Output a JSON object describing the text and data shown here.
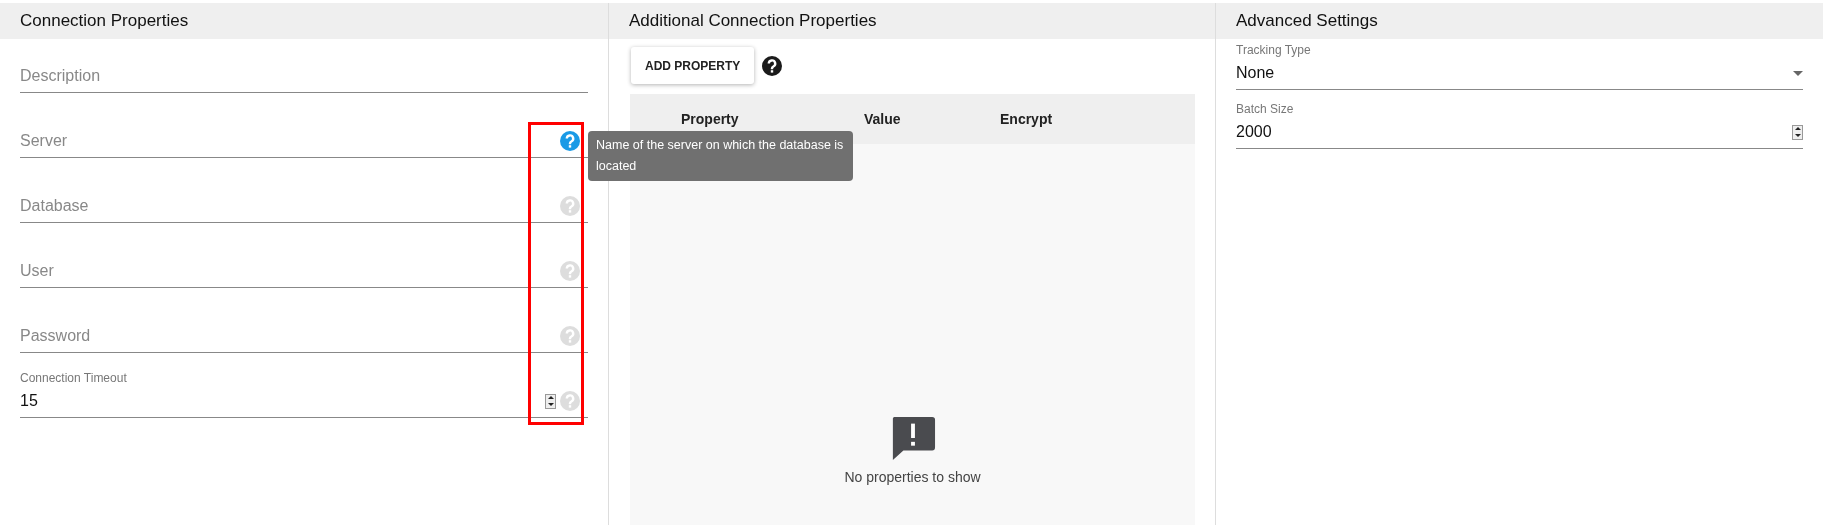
{
  "connection_properties": {
    "title": "Connection Properties",
    "fields": [
      {
        "kind": "text",
        "placeholder": "Description"
      },
      {
        "kind": "text",
        "placeholder": "Server",
        "help_highlighted": true
      },
      {
        "kind": "text",
        "placeholder": "Database",
        "help_highlighted": false
      },
      {
        "kind": "text",
        "placeholder": "User",
        "help_highlighted": false
      },
      {
        "kind": "password",
        "placeholder": "Password",
        "help_highlighted": false
      },
      {
        "kind": "number",
        "label": "Connection Timeout",
        "value": "15",
        "help_highlighted": false
      }
    ]
  },
  "additional_connection_properties": {
    "title": "Additional Connection Properties",
    "add_button": "ADD PROPERTY",
    "table": {
      "columns": [
        "Property",
        "Value",
        "Encrypt"
      ],
      "empty_message": "No properties to show"
    }
  },
  "advanced_settings": {
    "title": "Advanced Settings",
    "fields": [
      {
        "kind": "select",
        "label": "Tracking Type",
        "value": "None"
      },
      {
        "kind": "number",
        "label": "Batch Size",
        "value": "2000"
      }
    ]
  },
  "tooltip": {
    "text": "Name of the server on which the database is located"
  },
  "highlight": true
}
